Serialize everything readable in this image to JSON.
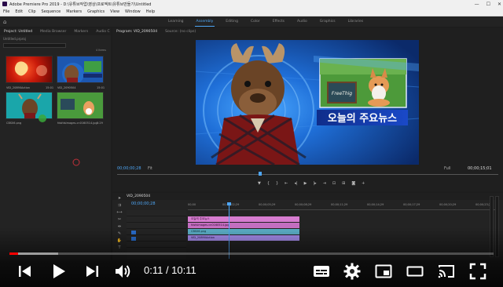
{
  "window": {
    "title": "Adobe Premiere Pro 2019 - D:\\유튜브작업\\영상\\프로젝트\\유튜브만들기\\Untitled",
    "controls": [
      "—",
      "☐",
      "✕"
    ]
  },
  "menu": [
    "File",
    "Edit",
    "Clip",
    "Sequence",
    "Markers",
    "Graphics",
    "View",
    "Window",
    "Help"
  ],
  "workspaces": {
    "tabs": [
      "Learning",
      "Assembly",
      "Editing",
      "Color",
      "Effects",
      "Audio",
      "Graphics",
      "Libraries"
    ],
    "active": 1
  },
  "project_panel": {
    "tabs": [
      "Project: Untitled",
      "Media Browser",
      "Markers",
      "Audio C"
    ],
    "subtitle": "Untitled.prproj",
    "items_count": "4 Items",
    "items": [
      {
        "name": "VID_20890Action",
        "duration": "15:01"
      },
      {
        "name": "VID_2090504",
        "duration": "15:01"
      },
      {
        "name": "CBS06.png",
        "duration": ""
      },
      {
        "name": "fdsfdsImages.cn0160514.jpg",
        "duration": "5:29"
      }
    ]
  },
  "program_panel": {
    "tabs": [
      "Program: VID_2090504",
      "Source: (no clips)"
    ],
    "timecode_left": "00;00;00;28",
    "fit_label": "Fit",
    "resolution_label": "Full",
    "timecode_right": "00;00;15;01"
  },
  "video": {
    "caption": "오늘의 주요뉴스",
    "badge_text": "FreeThig"
  },
  "timeline": {
    "sequence_name": "VID_2090504",
    "timecode": "00;00;00;28",
    "ruler": [
      "00;00",
      "00;00;02;29",
      "00;00;05;29",
      "00;00;08;29",
      "00;00;11;29",
      "00;00;14;29",
      "00;00;17;29",
      "00;00;20;29",
      "00;00;23;29"
    ],
    "clips": [
      {
        "label": "오늘의 주요뉴스"
      },
      {
        "label": "fdsfsImages.cn0160514.jpg"
      },
      {
        "label": "CBS06.png"
      },
      {
        "label": "VID_20890Action"
      }
    ]
  },
  "player": {
    "current_time": "0:11",
    "duration": "10:11",
    "time_display": "0:11 / 10:11",
    "progress_played": 0.018,
    "progress_loaded": 0.1
  }
}
